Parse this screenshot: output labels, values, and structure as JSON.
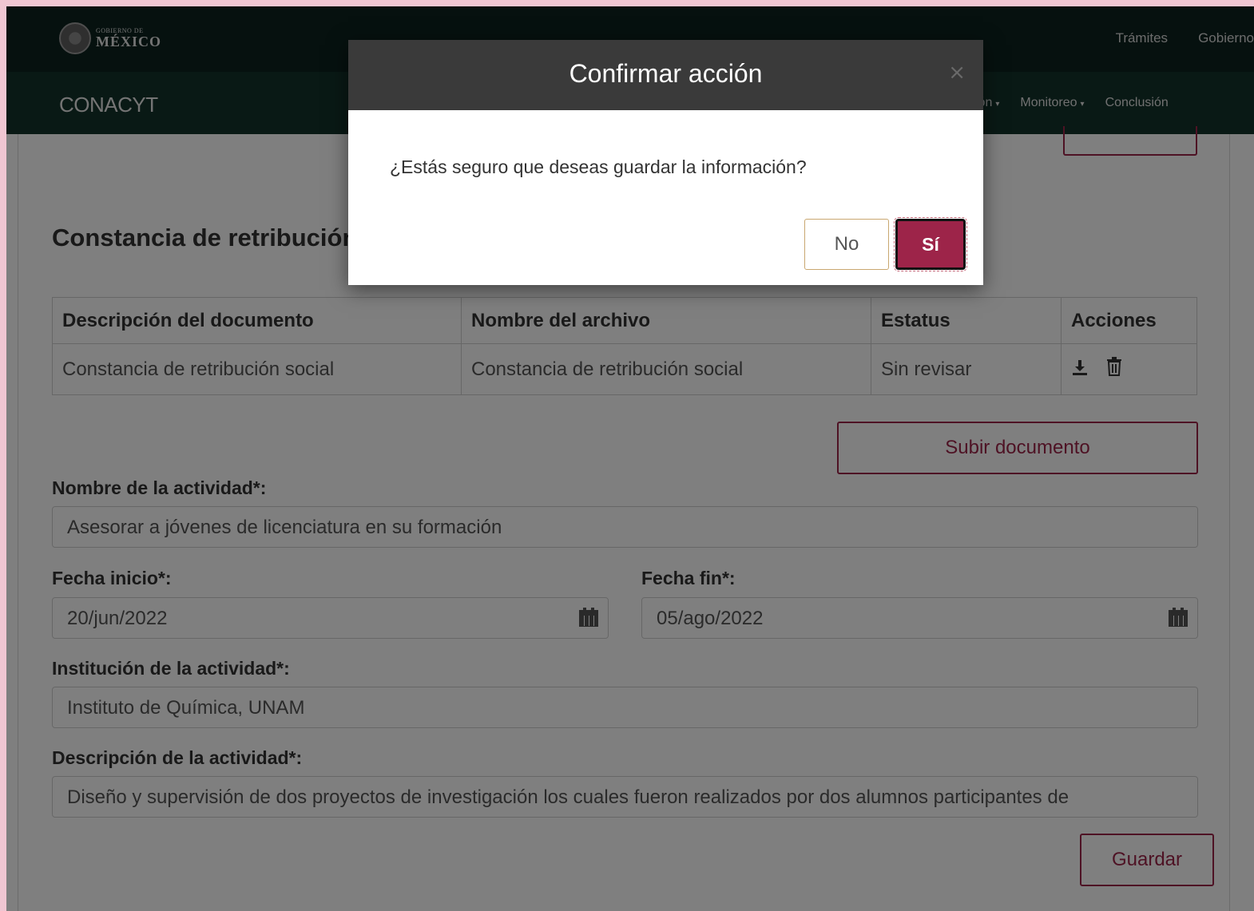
{
  "header": {
    "gov_logo_line1": "GOBIERNO DE",
    "gov_logo_line2": "MÉXICO",
    "links": [
      "Trámites",
      "Gobierno"
    ]
  },
  "appbar": {
    "title": "CONACYT",
    "nav": [
      "ción",
      "Monitoreo",
      "Conclusión"
    ]
  },
  "section": {
    "title": "Constancia de retribución social"
  },
  "table": {
    "headers": [
      "Descripción del documento",
      "Nombre del archivo",
      "Estatus",
      "Acciones"
    ],
    "rows": [
      [
        "Constancia de retribución social",
        "Constancia de retribución social",
        "Sin revisar"
      ]
    ],
    "action_icons": [
      "download-icon",
      "trash-icon"
    ]
  },
  "upload_button": "Subir documento",
  "form": {
    "nombre_label": "Nombre de la actividad*:",
    "nombre_value": "Asesorar a jóvenes de licenciatura en su formación",
    "fecha_inicio_label": "Fecha inicio*:",
    "fecha_inicio_value": "20/jun/2022",
    "fecha_fin_label": "Fecha fin*:",
    "fecha_fin_value": "05/ago/2022",
    "institucion_label": "Institución de la actividad*:",
    "institucion_value": "Instituto de Química, UNAM",
    "descripcion_label": "Descripción de la actividad*:",
    "descripcion_value": "Diseño y supervisión de dos proyectos de investigación los cuales fueron realizados por dos alumnos participantes de"
  },
  "save_button": "Guardar",
  "modal": {
    "title": "Confirmar acción",
    "close": "×",
    "message": "¿Estás seguro que deseas guardar la información?",
    "no_label": "No",
    "yes_label": "Sí"
  },
  "colors": {
    "brand": "#9d2449",
    "gov_bar": "#0c231e",
    "app_bar": "#13322b",
    "modal_header": "#3a3a3a"
  }
}
